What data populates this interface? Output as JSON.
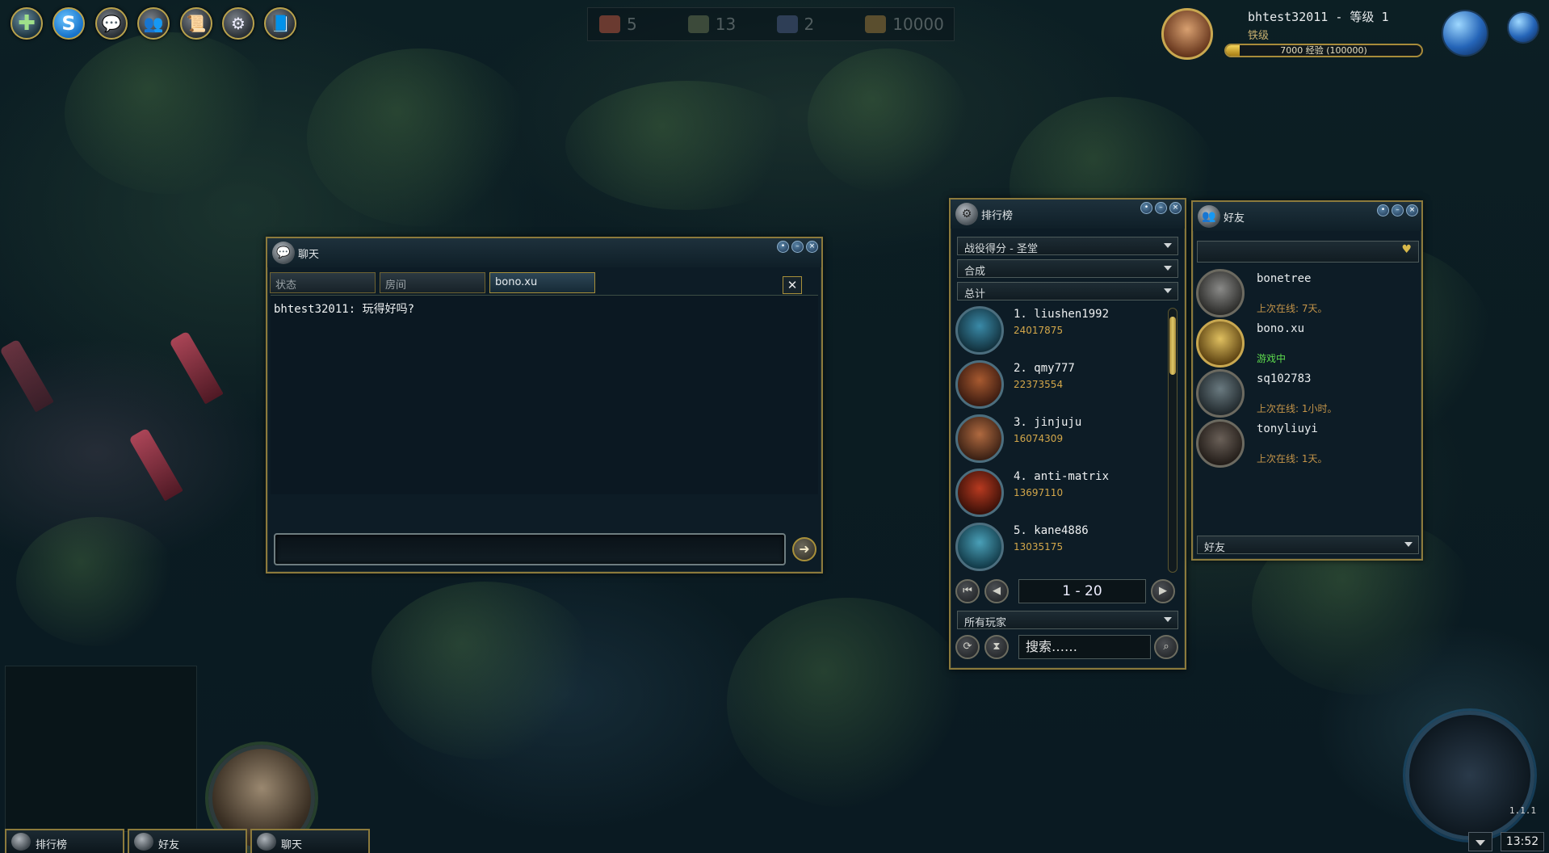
{
  "toolbar": {
    "buttons": [
      {
        "name": "add-button",
        "glyph": "✚"
      },
      {
        "name": "skype-button",
        "glyph": "S"
      },
      {
        "name": "chat-toolbar-button",
        "glyph": "💬"
      },
      {
        "name": "friends-toolbar-button",
        "glyph": "👥"
      },
      {
        "name": "scroll-toolbar-button",
        "glyph": "📜"
      },
      {
        "name": "ranking-toolbar-button",
        "glyph": "⚙"
      },
      {
        "name": "book-toolbar-button",
        "glyph": "📘"
      }
    ]
  },
  "resources": [
    {
      "name": "resource-red",
      "value": "5",
      "color": "#6a3a30"
    },
    {
      "name": "resource-green",
      "value": "13",
      "color": "#3c4a3a"
    },
    {
      "name": "resource-blue",
      "value": "2",
      "color": "#2e3e56"
    },
    {
      "name": "resource-gold",
      "value": "10000",
      "color": "#5a4e2e"
    }
  ],
  "profile": {
    "name_line": "bhtest32011 - 等级 1",
    "rank": "铁级",
    "xp_text": "7000 经验 (100000)",
    "xp_fraction": 0.07
  },
  "chat": {
    "title": "聊天",
    "tabs": [
      "状态",
      "房间",
      "bono.xu"
    ],
    "active_tab": 2,
    "close_glyph": "✕",
    "message": "bhtest32011: 玩得好吗?",
    "input_value": "",
    "send_glyph": "➜"
  },
  "ranking": {
    "title": "排行榜",
    "dropdowns": [
      "战役得分 - 圣堂",
      "合成",
      "总计"
    ],
    "rows": [
      {
        "label": "1.  liushen1992",
        "score": "24017875",
        "color": "#3a8aa8"
      },
      {
        "label": "2.  qmy777",
        "score": "22373554",
        "color": "#a85a30"
      },
      {
        "label": "3.  jinjuju",
        "score": "16074309",
        "color": "#b06a40"
      },
      {
        "label": "4.  anti-matrix",
        "score": "13697110",
        "color": "#b83a20"
      },
      {
        "label": "5.  kane4886",
        "score": "13035175",
        "color": "#4aa0b8"
      }
    ],
    "page_range": "1 - 20",
    "filter": "所有玩家",
    "search_placeholder": "搜索……"
  },
  "friends": {
    "title": "好友",
    "search_value": "",
    "list": [
      {
        "name": "bonetree",
        "status": "上次在线: 7天。",
        "online": false,
        "color": "#7a7a78"
      },
      {
        "name": "bono.xu",
        "status": "游戏中",
        "online": true,
        "color": "#c8a040"
      },
      {
        "name": "sq102783",
        "status": "上次在线: 1小时。",
        "online": false,
        "color": "#5a6a70"
      },
      {
        "name": "tonyliuyi",
        "status": "上次在线: 1天。",
        "online": false,
        "color": "#5a5048"
      }
    ],
    "filter": "好友"
  },
  "bottom_tabs": [
    "排行榜",
    "好友",
    "聊天"
  ],
  "version": "1.1.1",
  "clock": "13:52"
}
